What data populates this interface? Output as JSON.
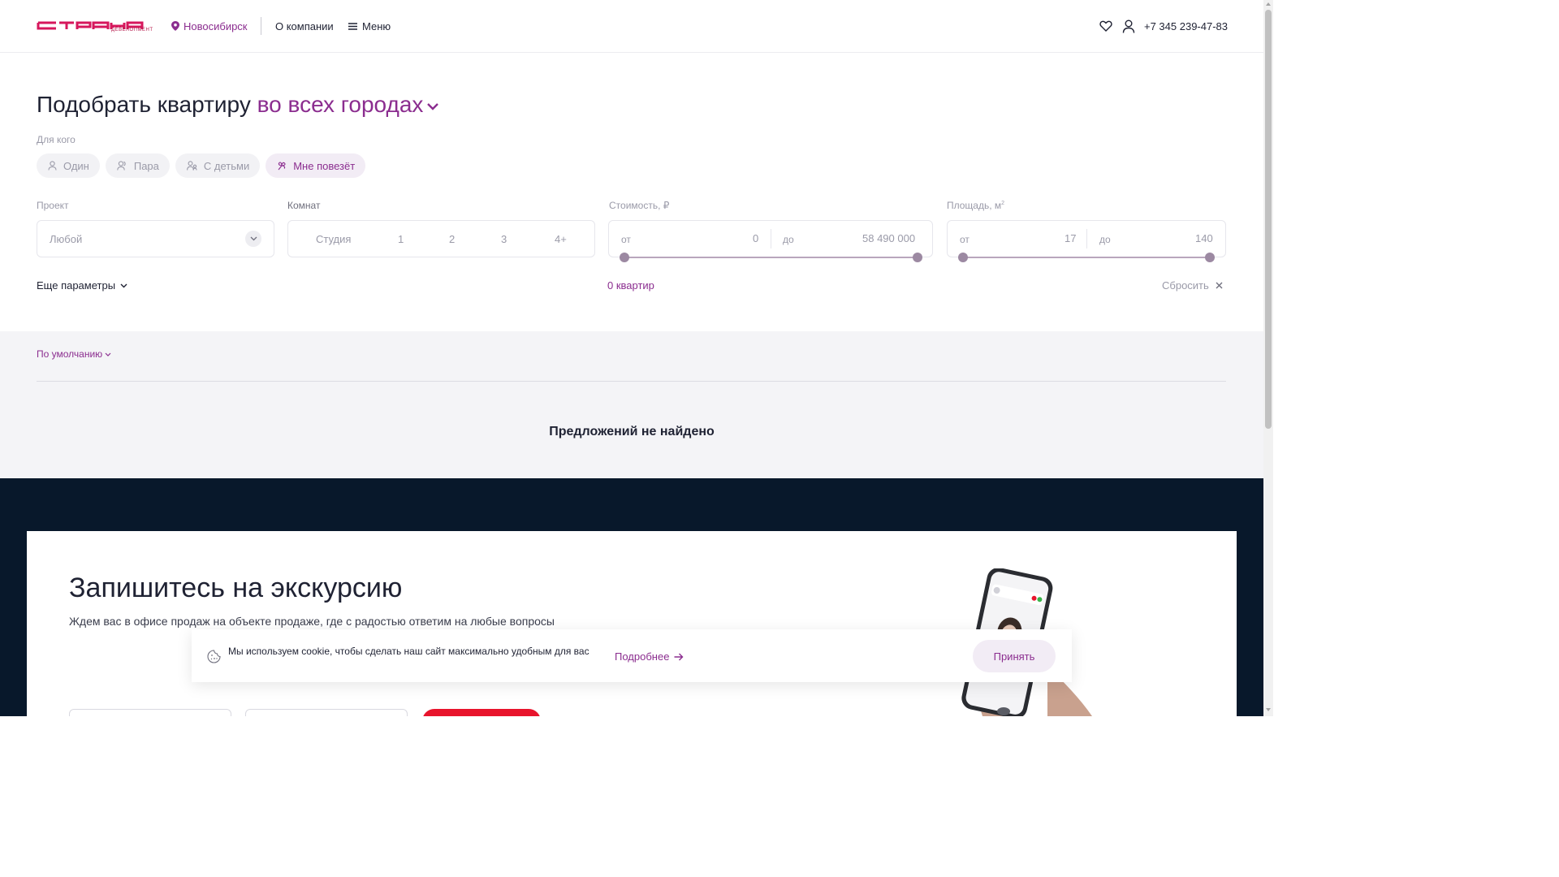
{
  "header": {
    "logo_text": "ДЕВЕЛОПМЕНТ",
    "city": "Новосибирск",
    "about": "О компании",
    "menu": "Меню",
    "phone": "+7 345 239-47-83"
  },
  "filter": {
    "title": "Подобрать квартиру",
    "title_accent": "во всех городах",
    "for_whom_label": "Для кого",
    "chips": [
      "Один",
      "Пара",
      "С детьми",
      "Мне повезёт"
    ],
    "project_label": "Проект",
    "project_value": "Любой",
    "rooms_label": "Комнат",
    "rooms": [
      "Студия",
      "1",
      "2",
      "3",
      "4+"
    ],
    "price_label": "Стоимость, ₽",
    "price_from_label": "от",
    "price_from": "0",
    "price_to_label": "до",
    "price_to": "58 490 000",
    "area_label": "Площадь, м",
    "area_sup": "2",
    "area_from_label": "от",
    "area_from": "17",
    "area_to_label": "до",
    "area_to": "140",
    "more_params": "Еще параметры",
    "count": "0 квартир",
    "reset": "Сбросить"
  },
  "results": {
    "sort": "По умолчанию",
    "empty": "Предложений не найдено"
  },
  "excursion": {
    "title": "Запишитесь на экскурсию",
    "subtitle": "Ждем вас в офисе продаж на объекте продаже, где с радостью ответим на любые вопросы"
  },
  "cookie": {
    "text": "Мы используем cookie, чтобы сделать наш сайт максимально удобным для вас",
    "more": "Подробнее",
    "accept": "Принять"
  },
  "colors": {
    "accent": "#8b2d8f",
    "brand": "#e8142c",
    "dark": "#08182b"
  }
}
